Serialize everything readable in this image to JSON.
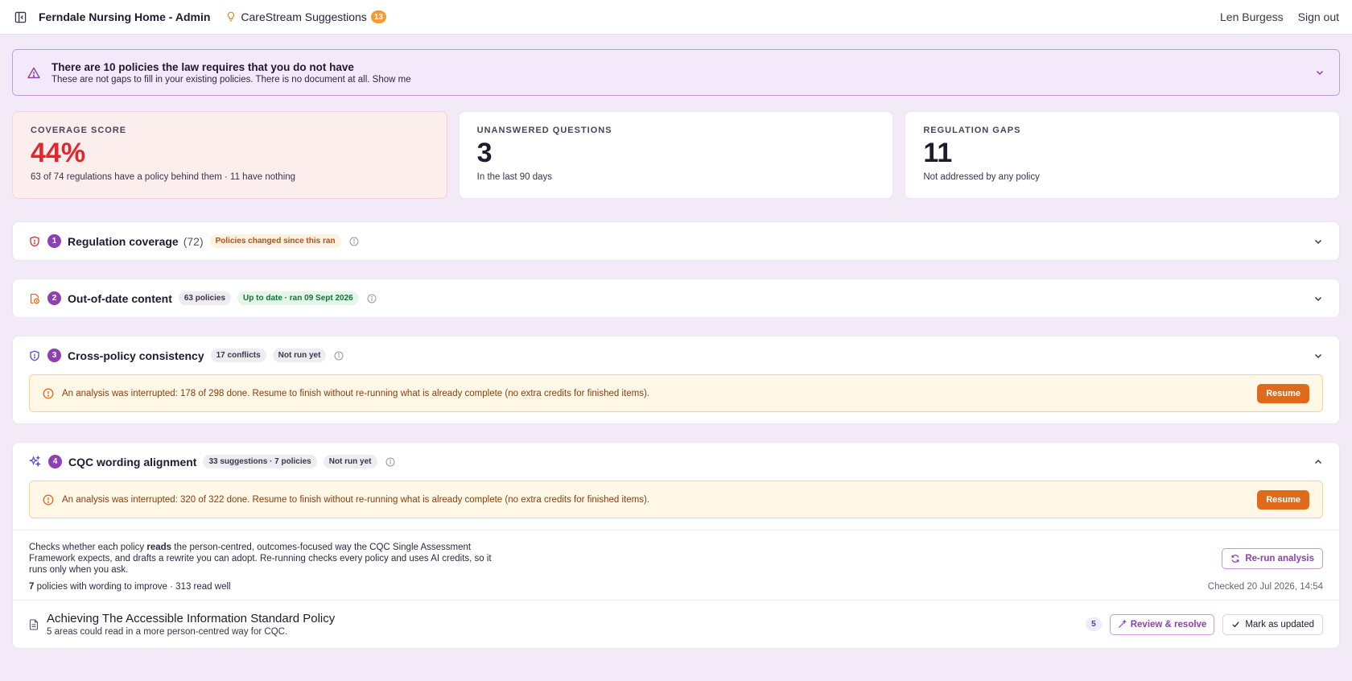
{
  "topbar": {
    "app_title": "Ferndale Nursing Home - Admin",
    "suggestions_label": "CareStream Suggestions",
    "suggestions_count": "13",
    "user_name": "Len Burgess",
    "sign_out": "Sign out"
  },
  "alert": {
    "title": "There are 10 policies the law requires that you do not have",
    "subtitle": "These are not gaps to fill in your existing policies. There is no document at all. Show me"
  },
  "stats": [
    {
      "label": "COVERAGE SCORE",
      "value": "44%",
      "sub": "63 of 74 regulations have a policy behind them · 11 have nothing"
    },
    {
      "label": "UNANSWERED QUESTIONS",
      "value": "3",
      "sub": "In the last 90 days"
    },
    {
      "label": "REGULATION GAPS",
      "value": "11",
      "sub": "Not addressed by any policy"
    }
  ],
  "sections": [
    {
      "num": "1",
      "title": "Regulation coverage",
      "count": "(72)",
      "pill": "Policies changed since this ran"
    },
    {
      "num": "2",
      "title": "Out-of-date content",
      "pill1": "63 policies",
      "pill2": "Up to date · ran 09 Sept 2026"
    },
    {
      "num": "3",
      "title": "Cross-policy consistency",
      "pill1": "17 conflicts",
      "pill2": "Not run yet",
      "warning": "An analysis was interrupted: 178 of 298 done. Resume to finish without re-running what is already complete (no extra credits for finished items).",
      "resume_label": "Resume"
    },
    {
      "num": "4",
      "title": "CQC wording alignment",
      "pill1": "33 suggestions · 7 policies",
      "pill2": "Not run yet",
      "warning": "An analysis was interrupted: 320 of 322 done. Resume to finish without re-running what is already complete (no extra credits for finished items).",
      "resume_label": "Resume",
      "desc_before": "Checks whether each policy ",
      "desc_bold": "reads",
      "desc_after": " the person-centred, outcomes-focused way the CQC Single Assessment Framework expects, and drafts a rewrite you can adopt. Re-running checks every policy and uses AI credits, so it runs only when you ask.",
      "rerun_label": "Re-run analysis",
      "summary_bold": "7",
      "summary_rest": " policies with wording to improve · 313 read well",
      "checked": "Checked 20 Jul 2026, 14:54",
      "policy": {
        "title": "Achieving The Accessible Information Standard Policy",
        "sub": "5 areas could read in a more person-centred way for CQC.",
        "count": "5",
        "review_label": "Review & resolve",
        "mark_label": "Mark as updated"
      }
    }
  ],
  "colors": {
    "accent": "#8e3fb1",
    "danger": "#e0262e",
    "warning": "#e06a1b"
  }
}
